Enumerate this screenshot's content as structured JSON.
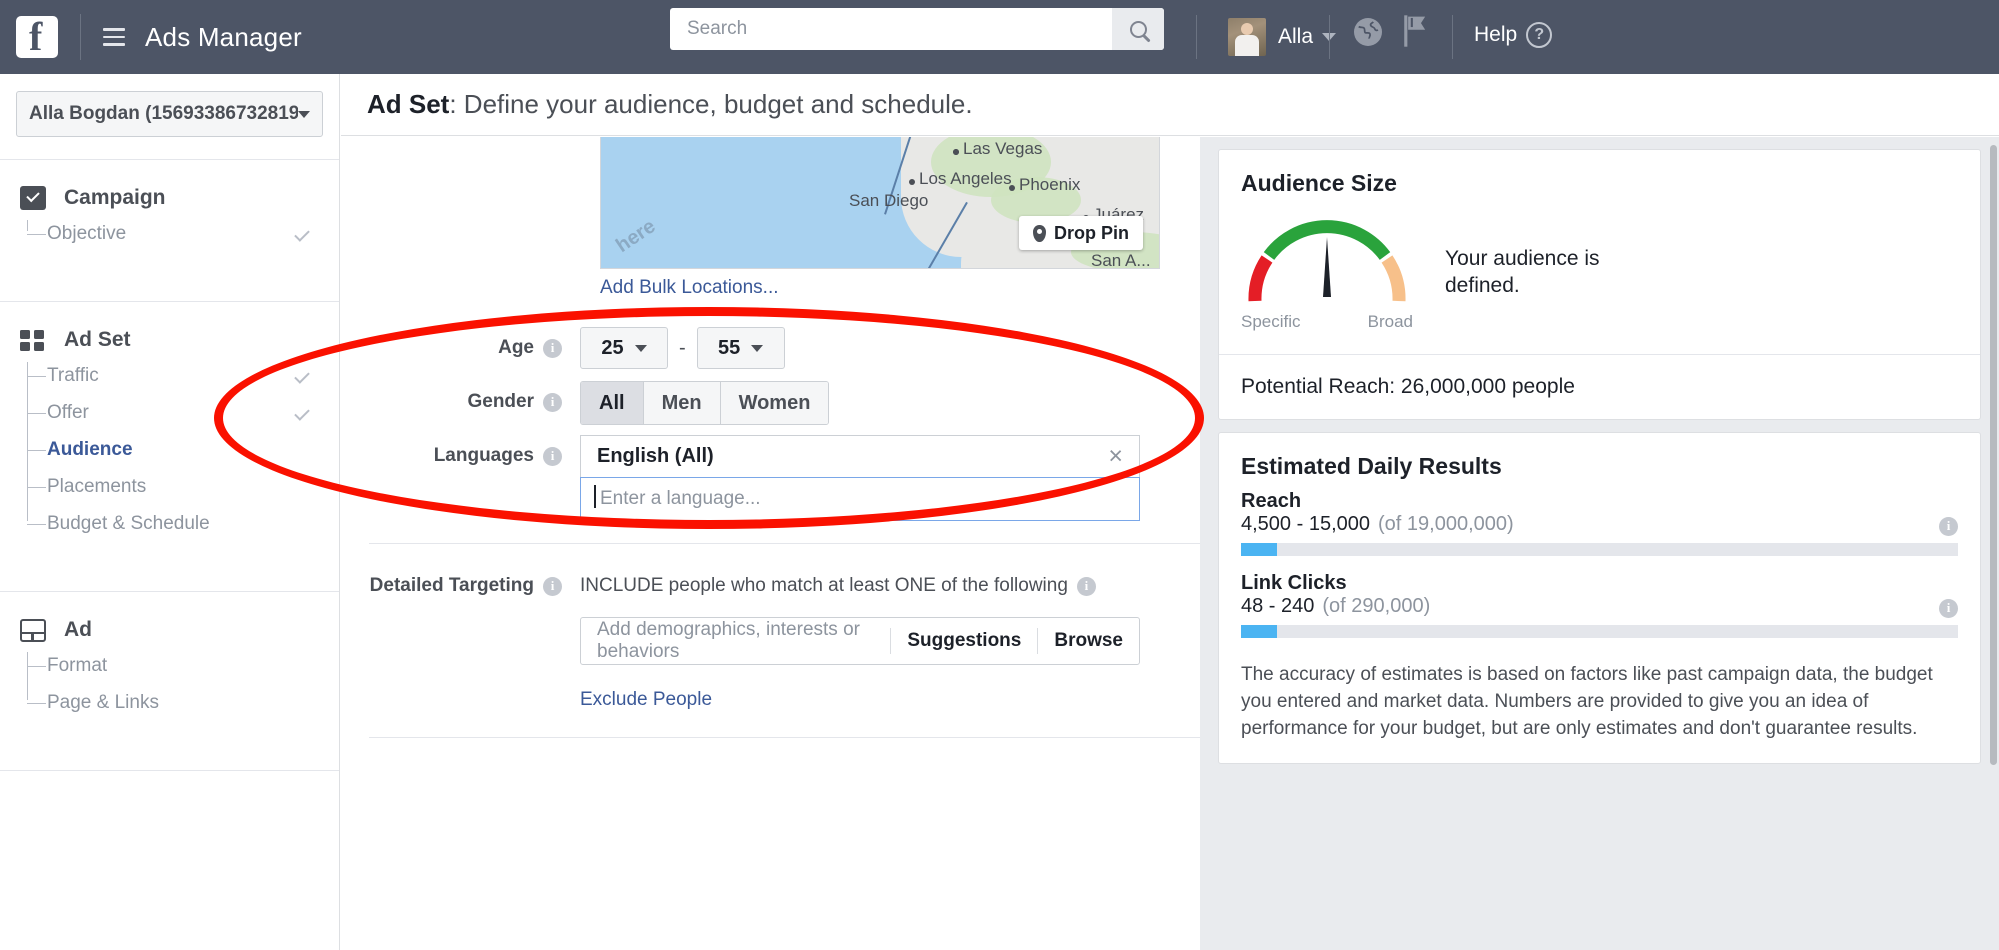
{
  "topbar": {
    "logo": "f",
    "menu_icon": "hamburger-icon",
    "app_title": "Ads Manager",
    "search": {
      "value": "",
      "placeholder": "Search",
      "icon": "search-icon"
    },
    "user": {
      "name": "Alla",
      "avatar": "user-avatar"
    },
    "globe_icon": "globe-icon",
    "flag_icon": "flag-icon",
    "help": {
      "label": "Help",
      "icon": "question-mark-icon"
    }
  },
  "sidebar": {
    "account": "Alla Bogdan (15693386732819...",
    "groups": [
      {
        "title": "Campaign",
        "icon": "campaign-checkbox-icon",
        "items": [
          {
            "label": "Objective",
            "checked": true,
            "active": false
          }
        ]
      },
      {
        "title": "Ad Set",
        "icon": "adset-grid-icon",
        "items": [
          {
            "label": "Traffic",
            "checked": true,
            "active": false
          },
          {
            "label": "Offer",
            "checked": true,
            "active": false
          },
          {
            "label": "Audience",
            "checked": false,
            "active": true
          },
          {
            "label": "Placements",
            "checked": false,
            "active": false
          },
          {
            "label": "Budget & Schedule",
            "checked": false,
            "active": false
          }
        ]
      },
      {
        "title": "Ad",
        "icon": "ad-layout-icon",
        "items": [
          {
            "label": "Format",
            "checked": false,
            "active": false
          },
          {
            "label": "Page & Links",
            "checked": false,
            "active": false
          }
        ]
      }
    ]
  },
  "main": {
    "header_bold": "Ad Set",
    "header_rest": ": Define your audience, budget and schedule."
  },
  "map": {
    "cities": [
      "Las Vegas",
      "Los Angeles",
      "Phoenix",
      "San Diego",
      "Juárez",
      "San A..."
    ],
    "attribution": "here",
    "drop_pin_label": "Drop Pin",
    "drop_pin_icon": "map-pin-icon"
  },
  "form": {
    "bulk_locations_link": "Add Bulk Locations...",
    "age": {
      "label": "Age",
      "info_icon": "info-icon",
      "min": "25",
      "max": "55",
      "separator": "-"
    },
    "gender": {
      "label": "Gender",
      "info_icon": "info-icon",
      "options": [
        "All",
        "Men",
        "Women"
      ],
      "selected": "All"
    },
    "languages": {
      "label": "Languages",
      "info_icon": "info-icon",
      "tokens": [
        "English (All)"
      ],
      "remove_icon": "close-x-icon",
      "placeholder": "Enter a language..."
    },
    "detailed_targeting": {
      "label": "Detailed Targeting",
      "info_icon": "info-icon",
      "include_text": "INCLUDE people who match at least ONE of the following",
      "include_info_icon": "info-icon",
      "input_placeholder": "Add demographics, interests or behaviors",
      "suggestions_label": "Suggestions",
      "browse_label": "Browse",
      "exclude_link": "Exclude People"
    }
  },
  "right_panel": {
    "audience_size": {
      "title": "Audience Size",
      "gauge_low_label": "Specific",
      "gauge_high_label": "Broad",
      "message": "Your audience is defined.",
      "potential_reach": "Potential Reach: 26,000,000 people",
      "colors": {
        "red": "#e41e26",
        "green": "#2aa33c",
        "orange": "#f7c08a",
        "needle": "#1d2129"
      }
    },
    "estimated_daily_results": {
      "title": "Estimated Daily Results",
      "metrics": [
        {
          "name": "Reach",
          "value": "4,500 - 15,000",
          "of": "(of 19,000,000)",
          "bar_percent": 5,
          "info_icon": "info-icon"
        },
        {
          "name": "Link Clicks",
          "value": "48 - 240",
          "of": "(of 290,000)",
          "bar_percent": 5,
          "info_icon": "info-icon"
        }
      ],
      "accuracy_note": "The accuracy of estimates is based on factors like past campaign data, the budget you entered and market data. Numbers are provided to give you an idea of performance for your budget, but are only estimates and don't guarantee results.",
      "bar_color": "#4bb4f2"
    }
  },
  "annotation": {
    "shape": "red-ellipse-highlight",
    "color": "#fa1100"
  }
}
